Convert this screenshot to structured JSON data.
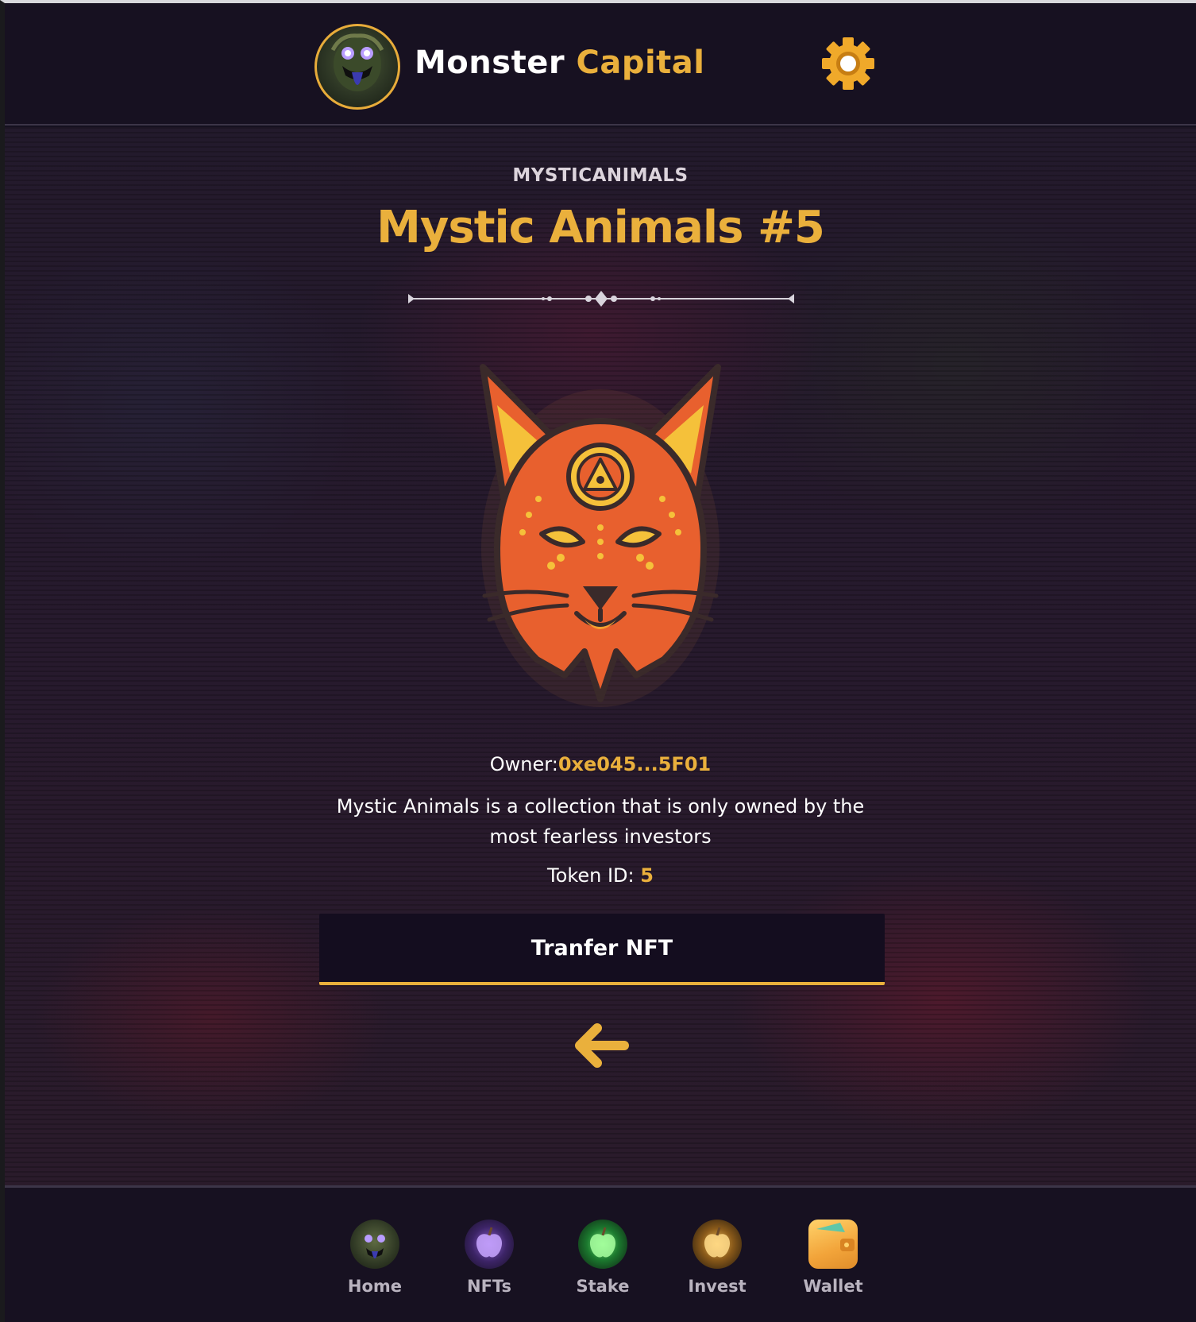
{
  "header": {
    "brand_first": "Monster",
    "brand_second": "Capital",
    "logo_icon": "monster-avatar-icon",
    "settings_icon": "gear-icon"
  },
  "nft": {
    "collection": "MYSTICANIMALS",
    "title": "Mystic Animals #5",
    "image_icon": "lynx-mystic-icon",
    "owner_label": "Owner:",
    "owner_address": "0xe045...5F01",
    "description": "Mystic Animals is a collection that is only owned by the most fearless investors",
    "token_label": "Token ID:",
    "token_id": "5"
  },
  "actions": {
    "transfer_label": "Tranfer NFT",
    "back_icon": "arrow-left-icon"
  },
  "bottom_nav": {
    "items": [
      {
        "label": "Home",
        "icon": "monster-home-icon"
      },
      {
        "label": "NFTs",
        "icon": "purple-apple-icon"
      },
      {
        "label": "Stake",
        "icon": "green-apple-icon"
      },
      {
        "label": "Invest",
        "icon": "gold-apple-icon"
      },
      {
        "label": "Wallet",
        "icon": "wallet-icon"
      }
    ]
  },
  "colors": {
    "accent": "#eab03c",
    "background": "#171121",
    "button": "#140d1f"
  }
}
